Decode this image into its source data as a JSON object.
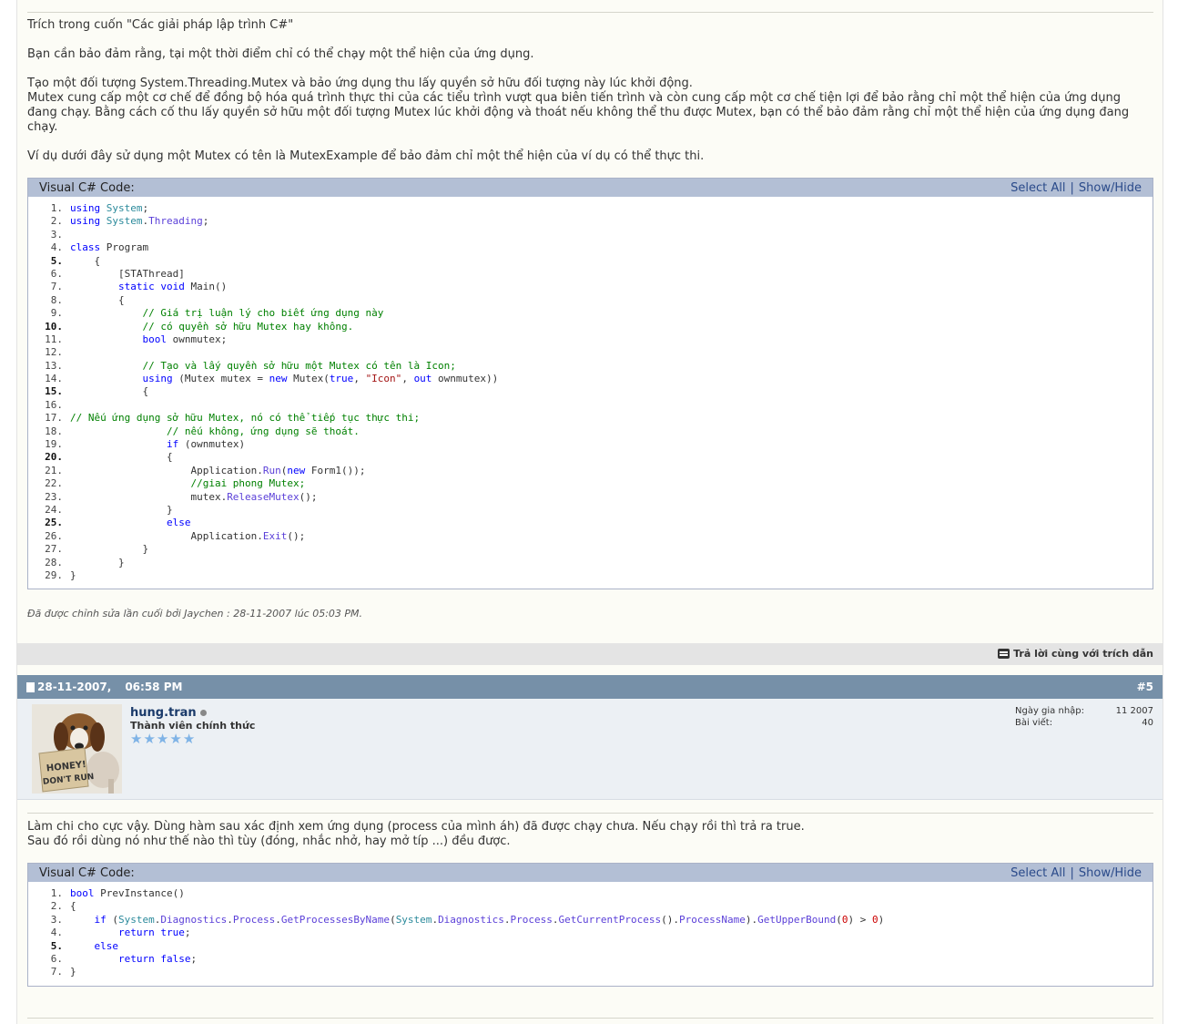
{
  "post4": {
    "para1": "Trích trong cuốn \"Các giải pháp lập trình C#\"",
    "para2": "Bạn cần bảo đảm rằng, tại một thời điểm chỉ có thể chạy một thể hiện của ứng dụng.",
    "para3_1": "Tạo một đối tượng System.Threading.Mutex và bảo ứng dụng thu lấy quyền sở hữu đối tượng này lúc khởi động.",
    "para3_2": "Mutex cung cấp một cơ chế để đồng bộ hóa quá trình thực thi của các tiểu trình vượt qua biên tiến trình và còn cung cấp một cơ chế tiện lợi để bảo rằng chỉ một thể hiện của ứng dụng đang chạy. Bằng cách cố thu lấy quyền sở hữu một đối tượng Mutex lúc khởi động và thoát nếu không thể thu được Mutex, bạn có thể bảo đảm rằng chỉ một thể hiện của ứng dụng đang chạy.",
    "para4": "Ví dụ dưới đây sử dụng một Mutex có tên là MutexExample để bảo đảm chỉ một thể hiện của ví dụ có thể thực thi.",
    "code_title": "Visual C# Code:",
    "select_all": "Select All",
    "separator": "|",
    "show_hide": "Show/Hide",
    "code_lines": [
      "using System;",
      "using System.Threading;",
      "",
      "class Program",
      "    {",
      "        [STAThread]",
      "        static void Main()",
      "        {",
      "            // Giá trị luận lý cho biết ứng dụng này",
      "            // có quyền sở hữu Mutex hay không.",
      "            bool ownmutex;",
      "",
      "            // Tạo và lấy quyền sở hữu một Mutex có tên là Icon;",
      "            using (Mutex mutex = new Mutex(true, \"Icon\", out ownmutex))",
      "            {",
      "",
      "// Nếu ứng dụng sở hữu Mutex, nó có thể tiếp tục thực thi;",
      "                // nếu không, ứng dụng sẽ thoát.",
      "                if (ownmutex)",
      "                {",
      "                    Application.Run(new Form1());",
      "                    //giai phong Mutex;",
      "                    mutex.ReleaseMutex();",
      "                }",
      "                else",
      "                    Application.Exit();",
      "            }",
      "        }",
      "}"
    ],
    "edited_note": "Đã được chỉnh sửa lần cuối bởi Jaychen : 28-11-2007 lúc 05:03 PM.",
    "quote_reply": "Trả lời cùng với trích dẫn"
  },
  "post5": {
    "date": "28-11-2007,",
    "time": "06:58 PM",
    "post_number": "#5",
    "username": "hung.tran",
    "user_title": "Thành viên chính thức",
    "avatar_text_1": "HONEY!",
    "avatar_text_2": "DON'T RUN",
    "join_label": "Ngày gia nhập:",
    "join_value": "11 2007",
    "posts_label": "Bài viết:",
    "posts_value": "40",
    "text1": "Làm chi cho cực vậy. Dùng hàm sau xác định xem ứng dụng (process của mình áh) đã được chạy chưa. Nếu chạy rồi thì trả ra true.",
    "text2": "Sau đó rồi dùng nó như thế nào thì tùy (đóng, nhắc nhở, hay mở típ ...) đều được.",
    "code_title": "Visual C# Code:",
    "select_all": "Select All",
    "separator": "|",
    "show_hide": "Show/Hide",
    "code_lines": [
      "bool PrevInstance()",
      "{",
      "    if (System.Diagnostics.Process.GetProcessesByName(System.Diagnostics.Process.GetCurrentProcess().ProcessName).GetUpperBound(0) > 0)",
      "        return true;",
      "    else",
      "        return false;",
      "}"
    ]
  },
  "colors": {
    "page_bg": "#fcfcf6",
    "post_header": "#7690a8",
    "code_header": "#b3bfd5",
    "keyword": "#0000ff",
    "comment": "#008000",
    "string": "#a31515"
  }
}
